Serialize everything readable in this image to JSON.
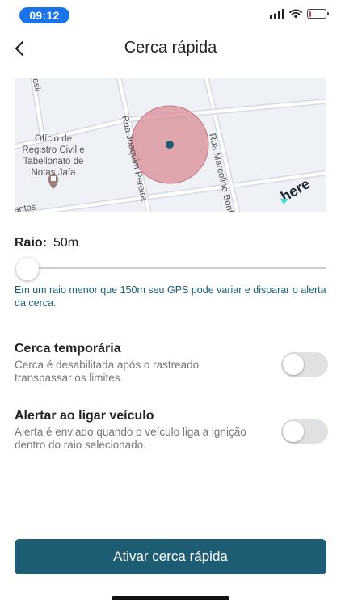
{
  "status_bar": {
    "time": "09:12",
    "battery_level": 0.15,
    "icons": [
      "cellular-signal-icon",
      "wifi-icon",
      "battery-low-icon"
    ]
  },
  "header": {
    "title": "Cerca rápida",
    "back_icon": "chevron-left-icon"
  },
  "map": {
    "streets": [
      "Rua Joaquim Pereira",
      "Rua Marcolino Bonf",
      "rasil",
      "antos"
    ],
    "poi_lines": [
      "Ofício de",
      "Registro Civil e",
      "Tabelionato de",
      "Notas Jafa"
    ],
    "logo": "here",
    "fence_color": "#d98c95",
    "center_color": "#1e5c73"
  },
  "radius": {
    "label": "Raio:",
    "value": "50m",
    "slider_level": 0.0,
    "hint": "Em um raio menor que 150m seu GPS pode variar e disparar o alerta da cerca."
  },
  "options": [
    {
      "title": "Cerca temporária",
      "description": "Cerca é desabilitada após o rastreado transpassar os limites.",
      "enabled": false
    },
    {
      "title": "Alertar ao ligar veículo",
      "description": "Alerta é enviado quando o veículo liga a ignição dentro do raio selecionado.",
      "enabled": false
    }
  ],
  "primary_button": {
    "label": "Ativar cerca rápida",
    "color": "#1e5c73"
  }
}
